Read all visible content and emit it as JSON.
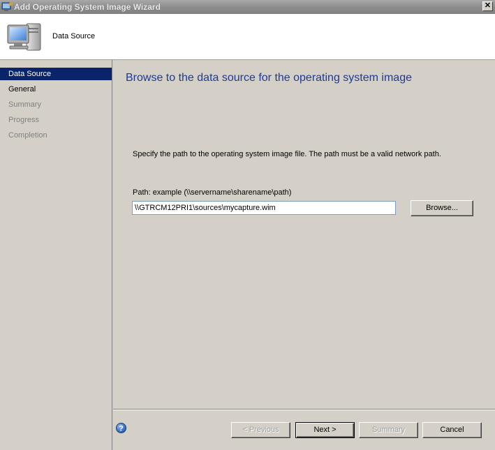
{
  "window": {
    "title": "Add Operating System Image Wizard",
    "close_label": "✕"
  },
  "header": {
    "page_title": "Data Source",
    "icon": "computer-icon"
  },
  "nav": {
    "items": [
      {
        "label": "Data Source",
        "state": "active"
      },
      {
        "label": "General",
        "state": "enabled"
      },
      {
        "label": "Summary",
        "state": "disabled"
      },
      {
        "label": "Progress",
        "state": "disabled"
      },
      {
        "label": "Completion",
        "state": "disabled"
      }
    ]
  },
  "main": {
    "title": "Browse to the data source for the operating system image",
    "instruction": "Specify the path to the operating system image file.  The path must be a valid network path.",
    "path_label": "Path: example (\\\\servername\\sharename\\path)",
    "path_value": "\\\\GTRCM12PRI1\\sources\\mycapture.wim",
    "browse_label": "Browse..."
  },
  "footer": {
    "previous_label": "< Previous",
    "next_label": "Next >",
    "summary_label": "Summary",
    "cancel_label": "Cancel",
    "help_icon": "help-icon"
  },
  "colors": {
    "accent": "#0a246a",
    "title_text": "#1f3a93",
    "background": "#d4d0c8"
  }
}
